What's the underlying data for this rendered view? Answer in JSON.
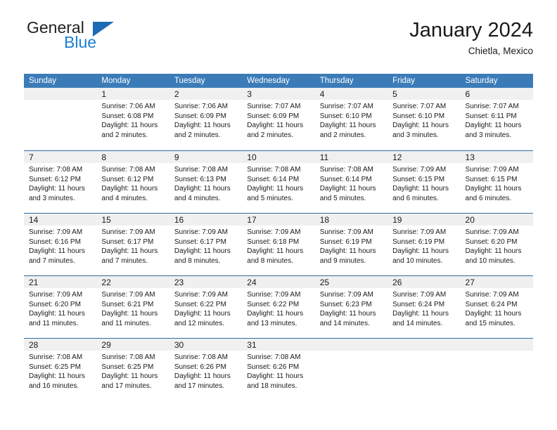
{
  "brand": {
    "name_part1": "General",
    "name_part2": "Blue",
    "triangle_icon": "triangle-icon",
    "accent_color": "#1b7fd4"
  },
  "header": {
    "title": "January 2024",
    "location": "Chietla, Mexico"
  },
  "calendar": {
    "header_bg": "#3b7cb8",
    "row_divider": "#2f6ca5",
    "day_band_bg": "#f0f0f0",
    "weekdays": [
      "Sunday",
      "Monday",
      "Tuesday",
      "Wednesday",
      "Thursday",
      "Friday",
      "Saturday"
    ],
    "weeks": [
      [
        {
          "day": "",
          "sunrise": "",
          "sunset": "",
          "daylight": "",
          "empty": true
        },
        {
          "day": "1",
          "sunrise": "Sunrise: 7:06 AM",
          "sunset": "Sunset: 6:08 PM",
          "daylight": "Daylight: 11 hours and 2 minutes."
        },
        {
          "day": "2",
          "sunrise": "Sunrise: 7:06 AM",
          "sunset": "Sunset: 6:09 PM",
          "daylight": "Daylight: 11 hours and 2 minutes."
        },
        {
          "day": "3",
          "sunrise": "Sunrise: 7:07 AM",
          "sunset": "Sunset: 6:09 PM",
          "daylight": "Daylight: 11 hours and 2 minutes."
        },
        {
          "day": "4",
          "sunrise": "Sunrise: 7:07 AM",
          "sunset": "Sunset: 6:10 PM",
          "daylight": "Daylight: 11 hours and 2 minutes."
        },
        {
          "day": "5",
          "sunrise": "Sunrise: 7:07 AM",
          "sunset": "Sunset: 6:10 PM",
          "daylight": "Daylight: 11 hours and 3 minutes."
        },
        {
          "day": "6",
          "sunrise": "Sunrise: 7:07 AM",
          "sunset": "Sunset: 6:11 PM",
          "daylight": "Daylight: 11 hours and 3 minutes."
        }
      ],
      [
        {
          "day": "7",
          "sunrise": "Sunrise: 7:08 AM",
          "sunset": "Sunset: 6:12 PM",
          "daylight": "Daylight: 11 hours and 3 minutes."
        },
        {
          "day": "8",
          "sunrise": "Sunrise: 7:08 AM",
          "sunset": "Sunset: 6:12 PM",
          "daylight": "Daylight: 11 hours and 4 minutes."
        },
        {
          "day": "9",
          "sunrise": "Sunrise: 7:08 AM",
          "sunset": "Sunset: 6:13 PM",
          "daylight": "Daylight: 11 hours and 4 minutes."
        },
        {
          "day": "10",
          "sunrise": "Sunrise: 7:08 AM",
          "sunset": "Sunset: 6:14 PM",
          "daylight": "Daylight: 11 hours and 5 minutes."
        },
        {
          "day": "11",
          "sunrise": "Sunrise: 7:08 AM",
          "sunset": "Sunset: 6:14 PM",
          "daylight": "Daylight: 11 hours and 5 minutes."
        },
        {
          "day": "12",
          "sunrise": "Sunrise: 7:09 AM",
          "sunset": "Sunset: 6:15 PM",
          "daylight": "Daylight: 11 hours and 6 minutes."
        },
        {
          "day": "13",
          "sunrise": "Sunrise: 7:09 AM",
          "sunset": "Sunset: 6:15 PM",
          "daylight": "Daylight: 11 hours and 6 minutes."
        }
      ],
      [
        {
          "day": "14",
          "sunrise": "Sunrise: 7:09 AM",
          "sunset": "Sunset: 6:16 PM",
          "daylight": "Daylight: 11 hours and 7 minutes."
        },
        {
          "day": "15",
          "sunrise": "Sunrise: 7:09 AM",
          "sunset": "Sunset: 6:17 PM",
          "daylight": "Daylight: 11 hours and 7 minutes."
        },
        {
          "day": "16",
          "sunrise": "Sunrise: 7:09 AM",
          "sunset": "Sunset: 6:17 PM",
          "daylight": "Daylight: 11 hours and 8 minutes."
        },
        {
          "day": "17",
          "sunrise": "Sunrise: 7:09 AM",
          "sunset": "Sunset: 6:18 PM",
          "daylight": "Daylight: 11 hours and 8 minutes."
        },
        {
          "day": "18",
          "sunrise": "Sunrise: 7:09 AM",
          "sunset": "Sunset: 6:19 PM",
          "daylight": "Daylight: 11 hours and 9 minutes."
        },
        {
          "day": "19",
          "sunrise": "Sunrise: 7:09 AM",
          "sunset": "Sunset: 6:19 PM",
          "daylight": "Daylight: 11 hours and 10 minutes."
        },
        {
          "day": "20",
          "sunrise": "Sunrise: 7:09 AM",
          "sunset": "Sunset: 6:20 PM",
          "daylight": "Daylight: 11 hours and 10 minutes."
        }
      ],
      [
        {
          "day": "21",
          "sunrise": "Sunrise: 7:09 AM",
          "sunset": "Sunset: 6:20 PM",
          "daylight": "Daylight: 11 hours and 11 minutes."
        },
        {
          "day": "22",
          "sunrise": "Sunrise: 7:09 AM",
          "sunset": "Sunset: 6:21 PM",
          "daylight": "Daylight: 11 hours and 11 minutes."
        },
        {
          "day": "23",
          "sunrise": "Sunrise: 7:09 AM",
          "sunset": "Sunset: 6:22 PM",
          "daylight": "Daylight: 11 hours and 12 minutes."
        },
        {
          "day": "24",
          "sunrise": "Sunrise: 7:09 AM",
          "sunset": "Sunset: 6:22 PM",
          "daylight": "Daylight: 11 hours and 13 minutes."
        },
        {
          "day": "25",
          "sunrise": "Sunrise: 7:09 AM",
          "sunset": "Sunset: 6:23 PM",
          "daylight": "Daylight: 11 hours and 14 minutes."
        },
        {
          "day": "26",
          "sunrise": "Sunrise: 7:09 AM",
          "sunset": "Sunset: 6:24 PM",
          "daylight": "Daylight: 11 hours and 14 minutes."
        },
        {
          "day": "27",
          "sunrise": "Sunrise: 7:09 AM",
          "sunset": "Sunset: 6:24 PM",
          "daylight": "Daylight: 11 hours and 15 minutes."
        }
      ],
      [
        {
          "day": "28",
          "sunrise": "Sunrise: 7:08 AM",
          "sunset": "Sunset: 6:25 PM",
          "daylight": "Daylight: 11 hours and 16 minutes."
        },
        {
          "day": "29",
          "sunrise": "Sunrise: 7:08 AM",
          "sunset": "Sunset: 6:25 PM",
          "daylight": "Daylight: 11 hours and 17 minutes."
        },
        {
          "day": "30",
          "sunrise": "Sunrise: 7:08 AM",
          "sunset": "Sunset: 6:26 PM",
          "daylight": "Daylight: 11 hours and 17 minutes."
        },
        {
          "day": "31",
          "sunrise": "Sunrise: 7:08 AM",
          "sunset": "Sunset: 6:26 PM",
          "daylight": "Daylight: 11 hours and 18 minutes."
        },
        {
          "day": "",
          "sunrise": "",
          "sunset": "",
          "daylight": "",
          "empty": true
        },
        {
          "day": "",
          "sunrise": "",
          "sunset": "",
          "daylight": "",
          "empty": true
        },
        {
          "day": "",
          "sunrise": "",
          "sunset": "",
          "daylight": "",
          "empty": true
        }
      ]
    ]
  }
}
